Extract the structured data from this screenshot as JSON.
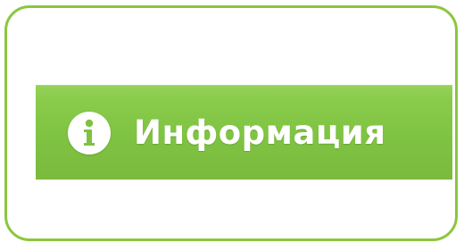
{
  "theme": {
    "accent": "#8cc63e",
    "bar_color": "#80c443",
    "text_color": "#ffffff"
  },
  "info_bar": {
    "icon": "info-icon",
    "label": "Информация"
  }
}
